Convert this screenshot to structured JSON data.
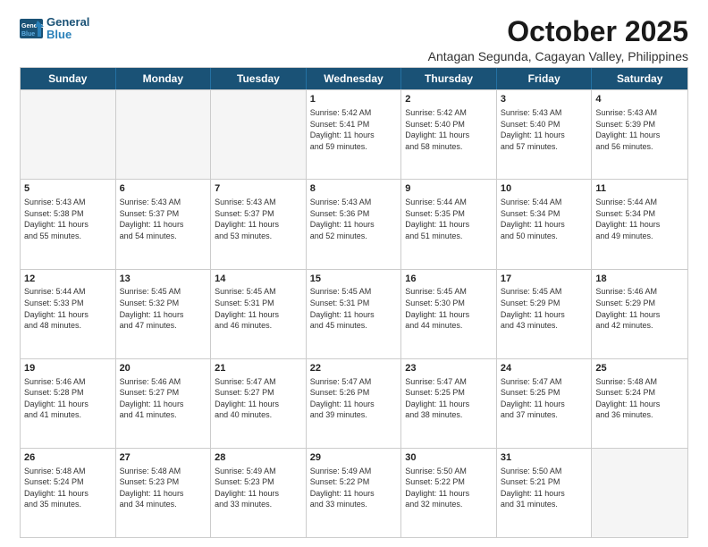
{
  "header": {
    "logo_line1": "General",
    "logo_line2": "Blue",
    "month": "October 2025",
    "location": "Antagan Segunda, Cagayan Valley, Philippines"
  },
  "days": [
    "Sunday",
    "Monday",
    "Tuesday",
    "Wednesday",
    "Thursday",
    "Friday",
    "Saturday"
  ],
  "weeks": [
    [
      {
        "num": "",
        "info": ""
      },
      {
        "num": "",
        "info": ""
      },
      {
        "num": "",
        "info": ""
      },
      {
        "num": "1",
        "info": "Sunrise: 5:42 AM\nSunset: 5:41 PM\nDaylight: 11 hours\nand 59 minutes."
      },
      {
        "num": "2",
        "info": "Sunrise: 5:42 AM\nSunset: 5:40 PM\nDaylight: 11 hours\nand 58 minutes."
      },
      {
        "num": "3",
        "info": "Sunrise: 5:43 AM\nSunset: 5:40 PM\nDaylight: 11 hours\nand 57 minutes."
      },
      {
        "num": "4",
        "info": "Sunrise: 5:43 AM\nSunset: 5:39 PM\nDaylight: 11 hours\nand 56 minutes."
      }
    ],
    [
      {
        "num": "5",
        "info": "Sunrise: 5:43 AM\nSunset: 5:38 PM\nDaylight: 11 hours\nand 55 minutes."
      },
      {
        "num": "6",
        "info": "Sunrise: 5:43 AM\nSunset: 5:37 PM\nDaylight: 11 hours\nand 54 minutes."
      },
      {
        "num": "7",
        "info": "Sunrise: 5:43 AM\nSunset: 5:37 PM\nDaylight: 11 hours\nand 53 minutes."
      },
      {
        "num": "8",
        "info": "Sunrise: 5:43 AM\nSunset: 5:36 PM\nDaylight: 11 hours\nand 52 minutes."
      },
      {
        "num": "9",
        "info": "Sunrise: 5:44 AM\nSunset: 5:35 PM\nDaylight: 11 hours\nand 51 minutes."
      },
      {
        "num": "10",
        "info": "Sunrise: 5:44 AM\nSunset: 5:34 PM\nDaylight: 11 hours\nand 50 minutes."
      },
      {
        "num": "11",
        "info": "Sunrise: 5:44 AM\nSunset: 5:34 PM\nDaylight: 11 hours\nand 49 minutes."
      }
    ],
    [
      {
        "num": "12",
        "info": "Sunrise: 5:44 AM\nSunset: 5:33 PM\nDaylight: 11 hours\nand 48 minutes."
      },
      {
        "num": "13",
        "info": "Sunrise: 5:45 AM\nSunset: 5:32 PM\nDaylight: 11 hours\nand 47 minutes."
      },
      {
        "num": "14",
        "info": "Sunrise: 5:45 AM\nSunset: 5:31 PM\nDaylight: 11 hours\nand 46 minutes."
      },
      {
        "num": "15",
        "info": "Sunrise: 5:45 AM\nSunset: 5:31 PM\nDaylight: 11 hours\nand 45 minutes."
      },
      {
        "num": "16",
        "info": "Sunrise: 5:45 AM\nSunset: 5:30 PM\nDaylight: 11 hours\nand 44 minutes."
      },
      {
        "num": "17",
        "info": "Sunrise: 5:45 AM\nSunset: 5:29 PM\nDaylight: 11 hours\nand 43 minutes."
      },
      {
        "num": "18",
        "info": "Sunrise: 5:46 AM\nSunset: 5:29 PM\nDaylight: 11 hours\nand 42 minutes."
      }
    ],
    [
      {
        "num": "19",
        "info": "Sunrise: 5:46 AM\nSunset: 5:28 PM\nDaylight: 11 hours\nand 41 minutes."
      },
      {
        "num": "20",
        "info": "Sunrise: 5:46 AM\nSunset: 5:27 PM\nDaylight: 11 hours\nand 41 minutes."
      },
      {
        "num": "21",
        "info": "Sunrise: 5:47 AM\nSunset: 5:27 PM\nDaylight: 11 hours\nand 40 minutes."
      },
      {
        "num": "22",
        "info": "Sunrise: 5:47 AM\nSunset: 5:26 PM\nDaylight: 11 hours\nand 39 minutes."
      },
      {
        "num": "23",
        "info": "Sunrise: 5:47 AM\nSunset: 5:25 PM\nDaylight: 11 hours\nand 38 minutes."
      },
      {
        "num": "24",
        "info": "Sunrise: 5:47 AM\nSunset: 5:25 PM\nDaylight: 11 hours\nand 37 minutes."
      },
      {
        "num": "25",
        "info": "Sunrise: 5:48 AM\nSunset: 5:24 PM\nDaylight: 11 hours\nand 36 minutes."
      }
    ],
    [
      {
        "num": "26",
        "info": "Sunrise: 5:48 AM\nSunset: 5:24 PM\nDaylight: 11 hours\nand 35 minutes."
      },
      {
        "num": "27",
        "info": "Sunrise: 5:48 AM\nSunset: 5:23 PM\nDaylight: 11 hours\nand 34 minutes."
      },
      {
        "num": "28",
        "info": "Sunrise: 5:49 AM\nSunset: 5:23 PM\nDaylight: 11 hours\nand 33 minutes."
      },
      {
        "num": "29",
        "info": "Sunrise: 5:49 AM\nSunset: 5:22 PM\nDaylight: 11 hours\nand 33 minutes."
      },
      {
        "num": "30",
        "info": "Sunrise: 5:50 AM\nSunset: 5:22 PM\nDaylight: 11 hours\nand 32 minutes."
      },
      {
        "num": "31",
        "info": "Sunrise: 5:50 AM\nSunset: 5:21 PM\nDaylight: 11 hours\nand 31 minutes."
      },
      {
        "num": "",
        "info": ""
      }
    ]
  ]
}
